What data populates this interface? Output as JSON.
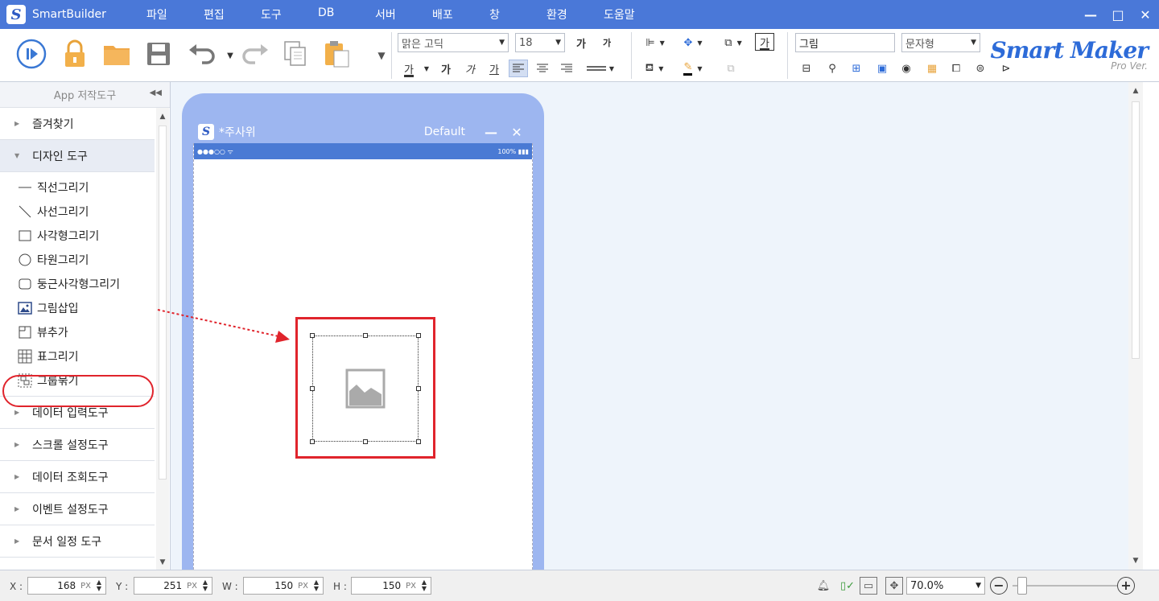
{
  "app": {
    "title": "SmartBuilder",
    "logo_letter": "S"
  },
  "menu": [
    "파일",
    "편집",
    "도구",
    "DB",
    "서버",
    "배포",
    "창",
    "환경",
    "도움말"
  ],
  "window_controls": {
    "minimize": "—",
    "maximize": "□",
    "close": "✕"
  },
  "toolbar": {
    "font_name": "맑은 고딕",
    "font_size": "18",
    "component_name": "그림",
    "component_type": "문자형",
    "bold_label": "가",
    "italic_label": "가",
    "underline_label": "가",
    "font_color_label": "가",
    "grow_label": "가",
    "shrink_label": "가",
    "text_box_label": "가"
  },
  "brand": {
    "main": "Smart Maker",
    "sub": "Pro Ver."
  },
  "panel": {
    "title": "App 저작도구",
    "categories_top": [
      {
        "label": "즐겨찾기",
        "open": false
      },
      {
        "label": "디자인 도구",
        "open": true
      }
    ],
    "design_tools": [
      {
        "label": "직선그리기",
        "icon": "line-icon"
      },
      {
        "label": "사선그리기",
        "icon": "diagonal-icon"
      },
      {
        "label": "사각형그리기",
        "icon": "rectangle-icon"
      },
      {
        "label": "타원그리기",
        "icon": "ellipse-icon"
      },
      {
        "label": "둥근사각형그리기",
        "icon": "rounded-rect-icon"
      },
      {
        "label": "그림삽입",
        "icon": "image-icon"
      },
      {
        "label": "뷰추가",
        "icon": "view-icon"
      },
      {
        "label": "표그리기",
        "icon": "table-icon"
      },
      {
        "label": "그룹묶기",
        "icon": "group-icon"
      }
    ],
    "categories_bottom": [
      {
        "label": "데이터 입력도구"
      },
      {
        "label": "스크롤 설정도구"
      },
      {
        "label": "데이터 조회도구"
      },
      {
        "label": "이벤트 설정도구"
      },
      {
        "label": "문서 일정 도구"
      }
    ]
  },
  "device": {
    "title": "*주사위",
    "mode": "Default",
    "status_left": "●●●○○ ᯤ",
    "status_right": "100% ▮▮▮"
  },
  "coords": {
    "x_label": "X :",
    "x": "168",
    "y_label": "Y :",
    "y": "251",
    "w_label": "W :",
    "w": "150",
    "h_label": "H :",
    "h": "150",
    "unit": "PX"
  },
  "zoom": {
    "value": "70.0%",
    "level": 0.05
  },
  "colors": {
    "titlebar": "#4a78d8",
    "accent": "#2d6bd8",
    "highlight": "#e0242c",
    "device_frame": "#9db6f0"
  }
}
